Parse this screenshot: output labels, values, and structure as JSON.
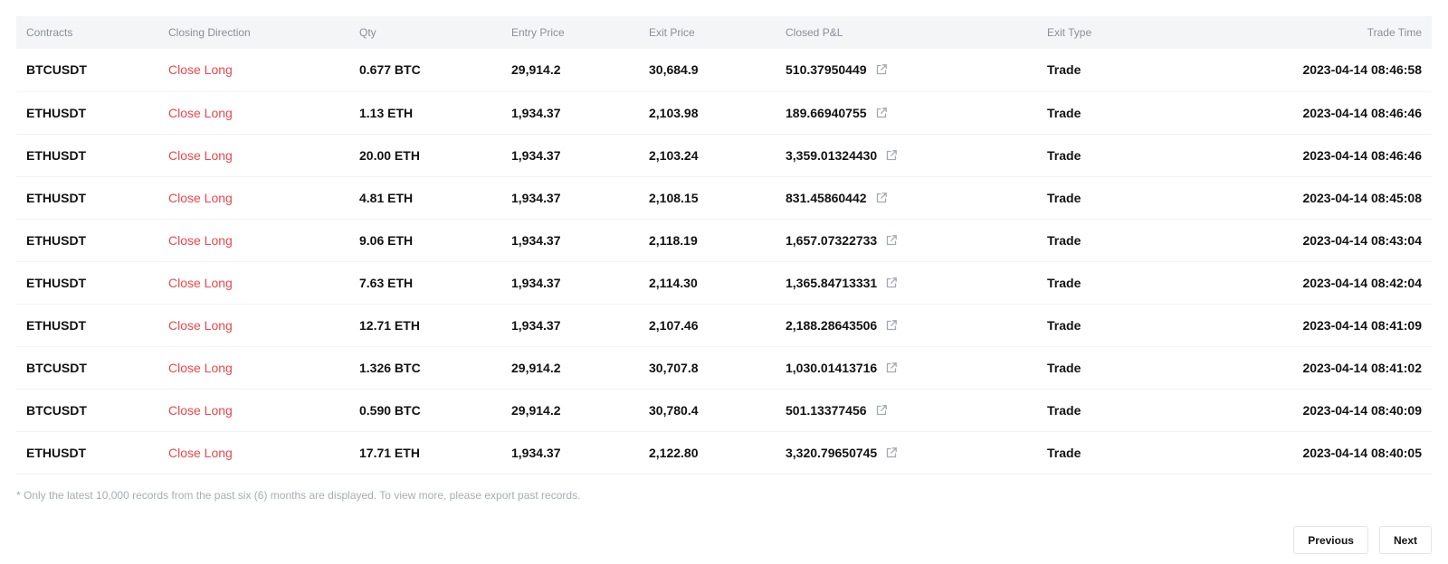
{
  "table": {
    "columns": {
      "contracts": "Contracts",
      "closing_direction": "Closing Direction",
      "qty": "Qty",
      "entry_price": "Entry Price",
      "exit_price": "Exit Price",
      "closed_pnl": "Closed P&L",
      "exit_type": "Exit Type",
      "trade_time": "Trade Time"
    },
    "rows": [
      {
        "contract": "BTCUSDT",
        "direction": "Close Long",
        "qty": "0.677 BTC",
        "entry_price": "29,914.2",
        "exit_price": "30,684.9",
        "pnl": "510.37950449",
        "exit_type": "Trade",
        "time": "2023-04-14 08:46:58"
      },
      {
        "contract": "ETHUSDT",
        "direction": "Close Long",
        "qty": "1.13 ETH",
        "entry_price": "1,934.37",
        "exit_price": "2,103.98",
        "pnl": "189.66940755",
        "exit_type": "Trade",
        "time": "2023-04-14 08:46:46"
      },
      {
        "contract": "ETHUSDT",
        "direction": "Close Long",
        "qty": "20.00 ETH",
        "entry_price": "1,934.37",
        "exit_price": "2,103.24",
        "pnl": "3,359.01324430",
        "exit_type": "Trade",
        "time": "2023-04-14 08:46:46"
      },
      {
        "contract": "ETHUSDT",
        "direction": "Close Long",
        "qty": "4.81 ETH",
        "entry_price": "1,934.37",
        "exit_price": "2,108.15",
        "pnl": "831.45860442",
        "exit_type": "Trade",
        "time": "2023-04-14 08:45:08"
      },
      {
        "contract": "ETHUSDT",
        "direction": "Close Long",
        "qty": "9.06 ETH",
        "entry_price": "1,934.37",
        "exit_price": "2,118.19",
        "pnl": "1,657.07322733",
        "exit_type": "Trade",
        "time": "2023-04-14 08:43:04"
      },
      {
        "contract": "ETHUSDT",
        "direction": "Close Long",
        "qty": "7.63 ETH",
        "entry_price": "1,934.37",
        "exit_price": "2,114.30",
        "pnl": "1,365.84713331",
        "exit_type": "Trade",
        "time": "2023-04-14 08:42:04"
      },
      {
        "contract": "ETHUSDT",
        "direction": "Close Long",
        "qty": "12.71 ETH",
        "entry_price": "1,934.37",
        "exit_price": "2,107.46",
        "pnl": "2,188.28643506",
        "exit_type": "Trade",
        "time": "2023-04-14 08:41:09"
      },
      {
        "contract": "BTCUSDT",
        "direction": "Close Long",
        "qty": "1.326 BTC",
        "entry_price": "29,914.2",
        "exit_price": "30,707.8",
        "pnl": "1,030.01413716",
        "exit_type": "Trade",
        "time": "2023-04-14 08:41:02"
      },
      {
        "contract": "BTCUSDT",
        "direction": "Close Long",
        "qty": "0.590 BTC",
        "entry_price": "29,914.2",
        "exit_price": "30,780.4",
        "pnl": "501.13377456",
        "exit_type": "Trade",
        "time": "2023-04-14 08:40:09"
      },
      {
        "contract": "ETHUSDT",
        "direction": "Close Long",
        "qty": "17.71 ETH",
        "entry_price": "1,934.37",
        "exit_price": "2,122.80",
        "pnl": "3,320.79650745",
        "exit_type": "Trade",
        "time": "2023-04-14 08:40:05"
      }
    ]
  },
  "icons": {
    "pnl_share": "external-link-icon"
  },
  "footer": {
    "note": "* Only the latest 10,000 records from the past six (6) months are displayed. To view more, please export past records."
  },
  "pagination": {
    "previous_label": "Previous",
    "next_label": "Next"
  },
  "colors": {
    "close_long": "#ef454a",
    "header_bg": "#f4f5f7",
    "header_text": "#8b8f97"
  }
}
